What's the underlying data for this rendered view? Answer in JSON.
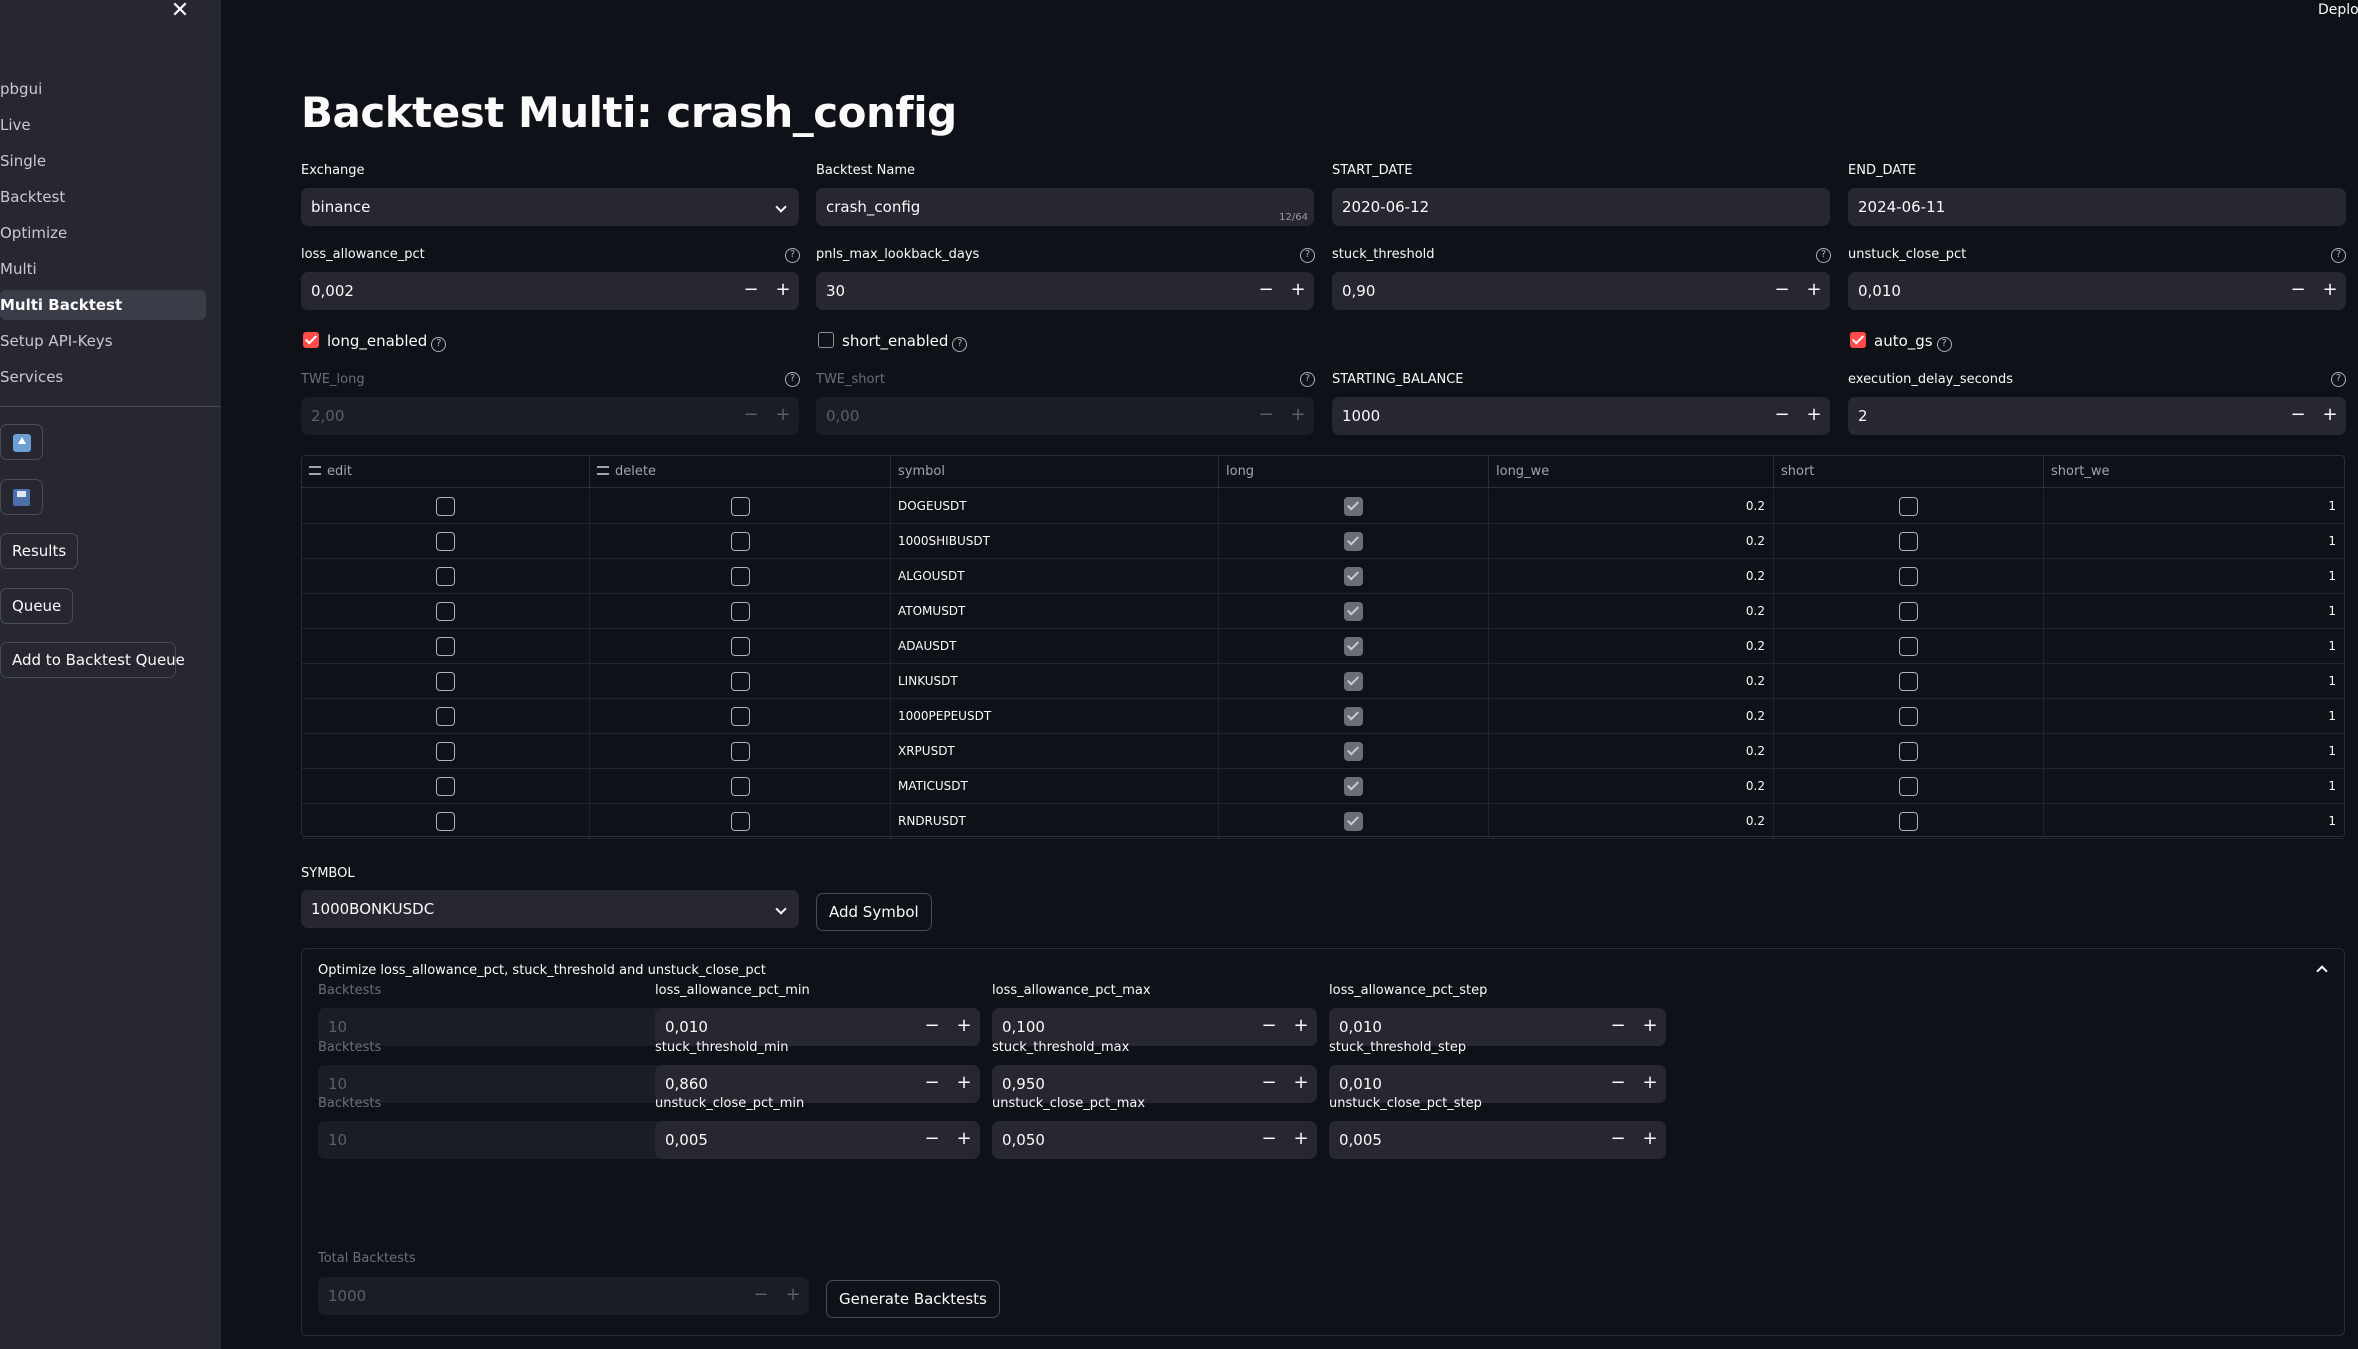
{
  "app": {
    "deploy_label": "Deploy"
  },
  "sidebar": {
    "close_label": "✕",
    "items": [
      {
        "label": "pbgui",
        "active": false
      },
      {
        "label": "Live",
        "active": false
      },
      {
        "label": "Single",
        "active": false
      },
      {
        "label": "Backtest",
        "active": false
      },
      {
        "label": "Optimize",
        "active": false
      },
      {
        "label": "Multi",
        "active": false
      },
      {
        "label": "Multi Backtest",
        "active": true
      },
      {
        "label": "Setup API-Keys",
        "active": false
      },
      {
        "label": "Services",
        "active": false
      }
    ],
    "upload_icon": "upload-icon",
    "save_icon": "floppy-disk-icon",
    "results_label": "Results",
    "queue_label": "Queue",
    "add_queue_label": "Add to Backtest Queue"
  },
  "main": {
    "title": "Backtest Multi: crash_config",
    "exchange": {
      "label": "Exchange",
      "value": "binance"
    },
    "backtest_name": {
      "label": "Backtest Name",
      "value": "crash_config",
      "counter": "12/64"
    },
    "start_date": {
      "label": "START_DATE",
      "value": "2020-06-12"
    },
    "end_date": {
      "label": "END_DATE",
      "value": "2024-06-11"
    },
    "loss_allowance_pct": {
      "label": "loss_allowance_pct",
      "value": "0,002"
    },
    "pnls_max_lookback_days": {
      "label": "pnls_max_lookback_days",
      "value": "30"
    },
    "stuck_threshold": {
      "label": "stuck_threshold",
      "value": "0,90"
    },
    "unstuck_close_pct": {
      "label": "unstuck_close_pct",
      "value": "0,010"
    },
    "long_enabled": {
      "label": "long_enabled",
      "checked": true
    },
    "short_enabled": {
      "label": "short_enabled",
      "checked": false
    },
    "auto_gs": {
      "label": "auto_gs",
      "checked": true
    },
    "twe_long": {
      "label": "TWE_long",
      "value": "2,00"
    },
    "twe_short": {
      "label": "TWE_short",
      "value": "0,00"
    },
    "starting_balance": {
      "label": "STARTING_BALANCE",
      "value": "1000"
    },
    "execution_delay_seconds": {
      "label": "execution_delay_seconds",
      "value": "2"
    },
    "help_glyph": "?",
    "minus": "−",
    "plus": "+"
  },
  "table": {
    "columns": [
      "edit",
      "delete",
      "symbol",
      "long",
      "long_we",
      "short",
      "short_we"
    ],
    "rows": [
      {
        "symbol": "DOGEUSDT",
        "long": true,
        "long_we": "0.2",
        "short": false,
        "short_we": "1"
      },
      {
        "symbol": "1000SHIBUSDT",
        "long": true,
        "long_we": "0.2",
        "short": false,
        "short_we": "1"
      },
      {
        "symbol": "ALGOUSDT",
        "long": true,
        "long_we": "0.2",
        "short": false,
        "short_we": "1"
      },
      {
        "symbol": "ATOMUSDT",
        "long": true,
        "long_we": "0.2",
        "short": false,
        "short_we": "1"
      },
      {
        "symbol": "ADAUSDT",
        "long": true,
        "long_we": "0.2",
        "short": false,
        "short_we": "1"
      },
      {
        "symbol": "LINKUSDT",
        "long": true,
        "long_we": "0.2",
        "short": false,
        "short_we": "1"
      },
      {
        "symbol": "1000PEPEUSDT",
        "long": true,
        "long_we": "0.2",
        "short": false,
        "short_we": "1"
      },
      {
        "symbol": "XRPUSDT",
        "long": true,
        "long_we": "0.2",
        "short": false,
        "short_we": "1"
      },
      {
        "symbol": "MATICUSDT",
        "long": true,
        "long_we": "0.2",
        "short": false,
        "short_we": "1"
      },
      {
        "symbol": "RNDRUSDT",
        "long": true,
        "long_we": "0.2",
        "short": false,
        "short_we": "1"
      }
    ]
  },
  "symbol_select": {
    "label": "SYMBOL",
    "value": "1000BONKUSDC",
    "add_label": "Add Symbol"
  },
  "optimize": {
    "title": "Optimize loss_allowance_pct, stuck_threshold and unstuck_close_pct",
    "rows": [
      {
        "backtests_label": "Backtests",
        "backtests_value": "10",
        "min_label": "loss_allowance_pct_min",
        "min_value": "0,010",
        "max_label": "loss_allowance_pct_max",
        "max_value": "0,100",
        "step_label": "loss_allowance_pct_step",
        "step_value": "0,010"
      },
      {
        "backtests_label": "Backtests",
        "backtests_value": "10",
        "min_label": "stuck_threshold_min",
        "min_value": "0,860",
        "max_label": "stuck_threshold_max",
        "max_value": "0,950",
        "step_label": "stuck_threshold_step",
        "step_value": "0,010"
      },
      {
        "backtests_label": "Backtests",
        "backtests_value": "10",
        "min_label": "unstuck_close_pct_min",
        "min_value": "0,005",
        "max_label": "unstuck_close_pct_max",
        "max_value": "0,050",
        "step_label": "unstuck_close_pct_step",
        "step_value": "0,005"
      }
    ],
    "total_label": "Total Backtests",
    "total_value": "1000",
    "generate_label": "Generate Backtests"
  },
  "colors": {
    "accent": "#ff4b4b",
    "background": "#0e1117",
    "sidebar": "#262730"
  }
}
